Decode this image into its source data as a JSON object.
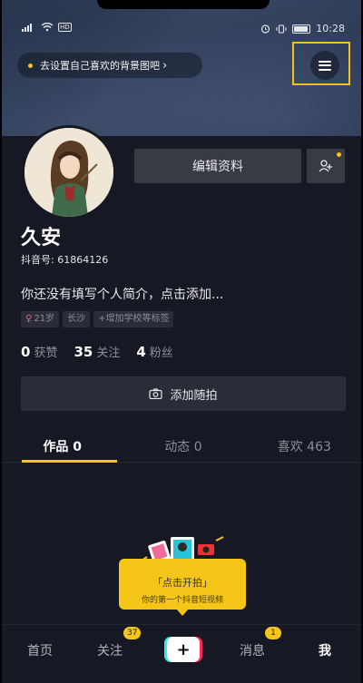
{
  "status_bar": {
    "network": "HD",
    "time": "10:28"
  },
  "background_prompt": {
    "text": "去设置自己喜欢的背景图吧",
    "chevron": "›"
  },
  "profile": {
    "name": "久安",
    "douyin_id": "抖音号: 61864126",
    "bio": "你还没有填写个人简介，点击添加...",
    "edit_profile_label": "编辑资料",
    "tags": {
      "age": "21岁",
      "city": "长沙",
      "add_school": "+增加学校等标签"
    },
    "stats": {
      "likes_num": "0",
      "likes_label": "获赞",
      "following_num": "35",
      "following_label": "关注",
      "followers_num": "4",
      "followers_label": "粉丝"
    },
    "add_snap_label": "添加随拍"
  },
  "tabs": {
    "works": "作品 0",
    "dynamics": "动态 0",
    "likes": "喜欢 463"
  },
  "prompt": {
    "main": "「点击开拍」",
    "sub": "你的第一个抖音短视频"
  },
  "bottom_nav": {
    "home": "首页",
    "following": "关注",
    "following_badge": "37",
    "create": "+",
    "messages": "消息",
    "messages_badge": "1",
    "me": "我"
  },
  "colors": {
    "accent": "#f5c518",
    "background": "#161823",
    "button": "#393b44"
  }
}
